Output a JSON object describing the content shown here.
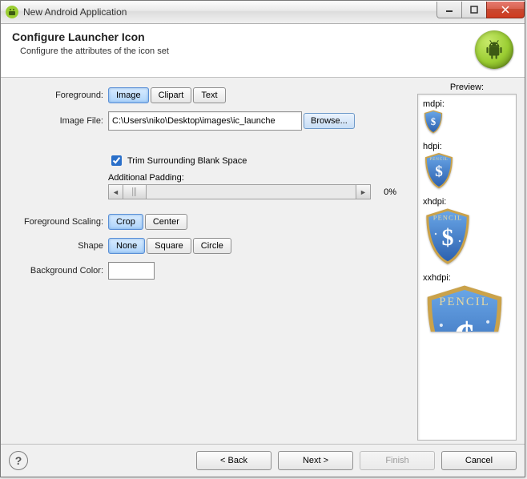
{
  "window": {
    "title": "New Android Application"
  },
  "header": {
    "title": "Configure Launcher Icon",
    "subtitle": "Configure the attributes of the icon set"
  },
  "form": {
    "foregroundLabel": "Foreground:",
    "foregroundOptions": {
      "image": "Image",
      "clipart": "Clipart",
      "text": "Text"
    },
    "imageFileLabel": "Image File:",
    "imageFileValue": "C:\\Users\\niko\\Desktop\\images\\ic_launche",
    "browseLabel": "Browse...",
    "trimLabel": "Trim Surrounding Blank Space",
    "trimChecked": true,
    "paddingLabel": "Additional Padding:",
    "paddingValue": "0%",
    "scalingLabel": "Foreground Scaling:",
    "scalingOptions": {
      "crop": "Crop",
      "center": "Center"
    },
    "shapeLabel": "Shape",
    "shapeOptions": {
      "none": "None",
      "square": "Square",
      "circle": "Circle"
    },
    "bgColorLabel": "Background Color:",
    "bgColorValue": "#ffffff"
  },
  "preview": {
    "title": "Preview:",
    "mdpi": "mdpi:",
    "hdpi": "hdpi:",
    "xhdpi": "xhdpi:",
    "xxhdpi": "xxhdpi:",
    "iconText": "PENCIL"
  },
  "footer": {
    "back": "< Back",
    "next": "Next >",
    "finish": "Finish",
    "cancel": "Cancel"
  }
}
